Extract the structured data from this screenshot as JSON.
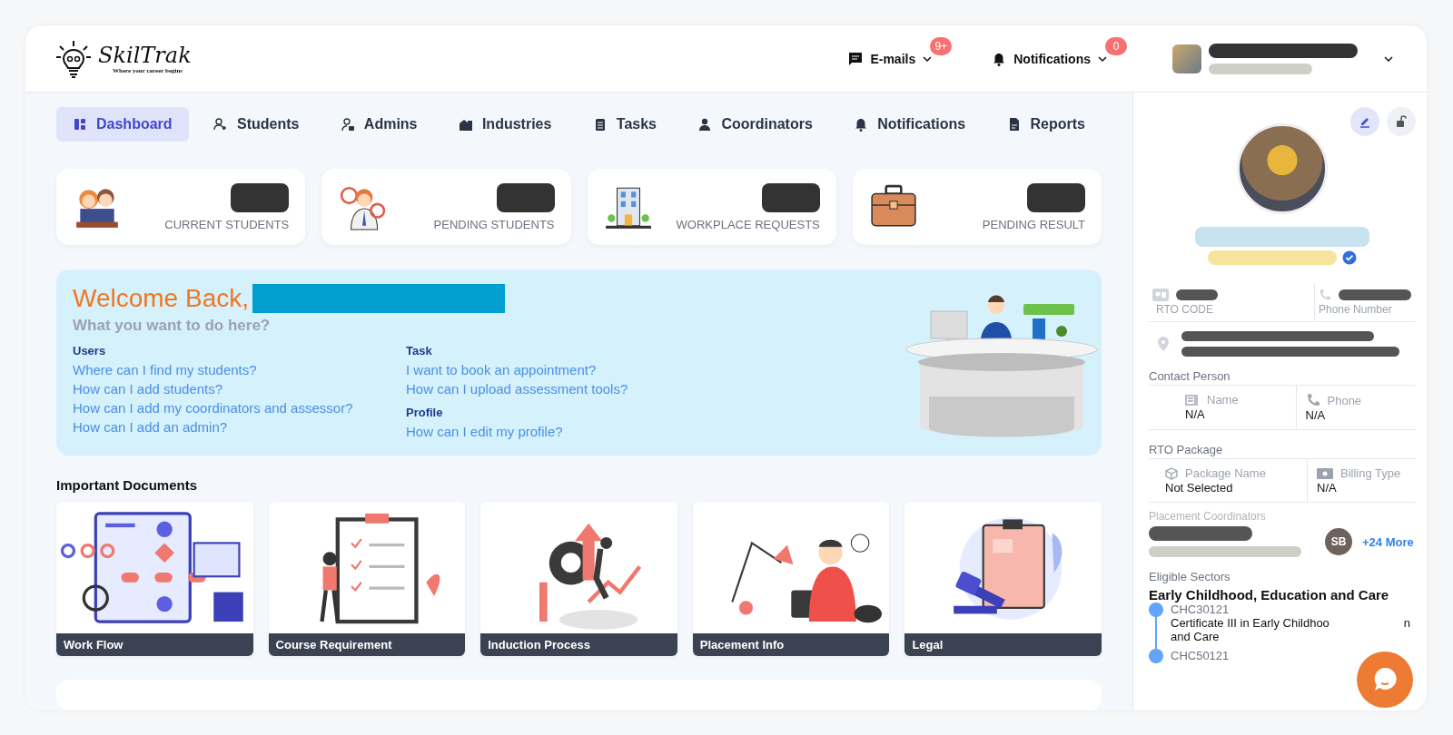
{
  "header": {
    "logo": {
      "name": "SkilTrak",
      "tagline": "Where your career begins"
    },
    "emails": {
      "label": "E-mails",
      "badge": "9+"
    },
    "notifications": {
      "label": "Notifications",
      "badge": "0"
    }
  },
  "nav": [
    {
      "label": "Dashboard",
      "selected": true
    },
    {
      "label": "Students",
      "selected": false
    },
    {
      "label": "Admins",
      "selected": false
    },
    {
      "label": "Industries",
      "selected": false
    },
    {
      "label": "Tasks",
      "selected": false
    },
    {
      "label": "Coordinators",
      "selected": false
    },
    {
      "label": "Notifications",
      "selected": false
    },
    {
      "label": "Reports",
      "selected": false
    }
  ],
  "stats": [
    {
      "label": "CURRENT STUDENTS"
    },
    {
      "label": "PENDING STUDENTS"
    },
    {
      "label": "WORKPLACE REQUESTS"
    },
    {
      "label": "PENDING RESULT"
    }
  ],
  "welcome": {
    "title": "Welcome Back,",
    "subtitle": "What you want to do here?",
    "groups": [
      {
        "heading": "Users",
        "links": [
          "Where can I find my students?",
          "How can I add students?",
          "How can I add my coordinators and assessor?",
          "How can I add an admin?"
        ]
      },
      {
        "heading": "Task",
        "links": [
          "I want to book an appointment?",
          "How can I upload assessment tools?"
        ]
      },
      {
        "heading": "Profile",
        "links": [
          "How can I edit my profile?"
        ]
      }
    ]
  },
  "documents": {
    "title": "Important Documents",
    "items": [
      {
        "label": "Work Flow"
      },
      {
        "label": "Course Requirement"
      },
      {
        "label": "Induction Process"
      },
      {
        "label": "Placement Info"
      },
      {
        "label": "Legal"
      }
    ]
  },
  "profile": {
    "rto_code_label": "RTO CODE",
    "phone_label": "Phone Number",
    "contact_person": {
      "title": "Contact Person",
      "fields": [
        {
          "label": "Name",
          "value": "N/A"
        },
        {
          "label": "Phone",
          "value": "N/A"
        }
      ]
    },
    "rto_package": {
      "title": "RTO Package",
      "fields": [
        {
          "label": "Package Name",
          "value": "Not Selected"
        },
        {
          "label": "Billing Type",
          "value": "N/A"
        }
      ]
    },
    "placement_coordinators": {
      "title": "Placement Coordinators",
      "avatar": "SB",
      "more": "+24 More"
    },
    "eligible_sectors": {
      "title": "Eligible Sectors",
      "sector": "Early Childhood, Education and Care",
      "courses": [
        {
          "code": "CHC30121",
          "name_line": "Certificate III in Early Childhoo",
          "name_tail": "n",
          "name_rest": "and Care"
        },
        {
          "code": "CHC50121"
        }
      ]
    }
  }
}
